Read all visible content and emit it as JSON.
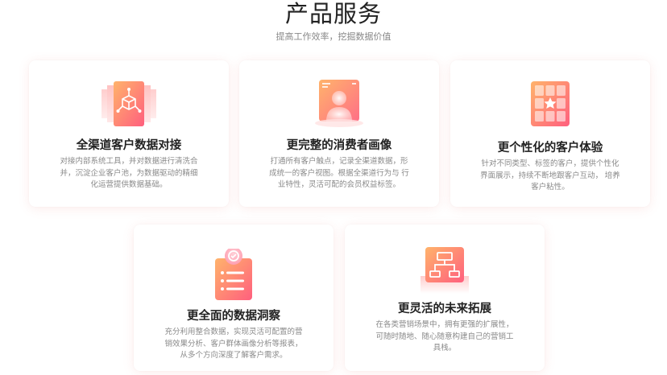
{
  "header": {
    "title": "产品服务",
    "subtitle": "提高工作效率，挖掘数据价值"
  },
  "colors": {
    "accent_start": "#ffb36b",
    "accent_end": "#ff5f7e",
    "title_text": "#222222",
    "desc_text": "#8a8a8a"
  },
  "cards": [
    {
      "icon": "network-cube-icon",
      "title": "全渠道客户数据对接",
      "description": "对接内部系统工具，并对数据进行清洗合并，沉淀企业客户池，为数据驱动的精细化运营提供数据基础。"
    },
    {
      "icon": "user-profile-icon",
      "title": "更完整的消费者画像",
      "description": "打通所有客户触点，记录全渠道数据，形成统一的客户视图。根据全渠道行为与 行业特性，灵活可配的会员权益标签。"
    },
    {
      "icon": "star-grid-icon",
      "title": "更个性化的客户体验",
      "description": "针对不同类型、标签的客户，提供个性化界面展示，持续不断地跟客户互动， 培养客户粘性。"
    },
    {
      "icon": "data-insight-icon",
      "title": "更全面的数据洞察",
      "description": "充分利用整合数据，实现灵活可配置的营销效果分析、客户群体画像分析等报表，从多个方向深度了解客户需求。"
    },
    {
      "icon": "expansion-structure-icon",
      "title": "更灵活的未来拓展",
      "description": "在各类营销场景中，拥有更强的扩展性，可随时随地、随心随意构建自己的营销工具栈。"
    }
  ]
}
